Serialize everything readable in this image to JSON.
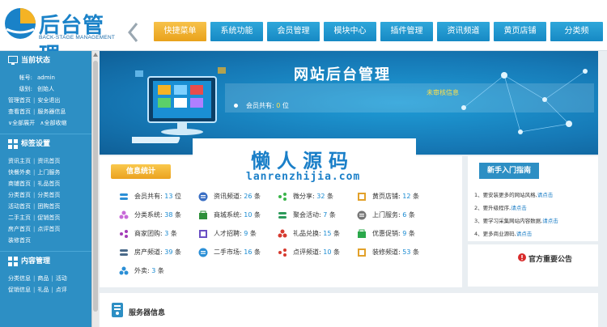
{
  "header": {
    "logo_title": "后台管理",
    "logo_subtitle": "BACK-STAGE MANAGEMENT",
    "nav": [
      "快捷菜单",
      "系统功能",
      "会员管理",
      "模块中心",
      "插件管理",
      "资讯频道",
      "黄页店铺",
      "分类频"
    ],
    "nav_active": 0
  },
  "sidebar": {
    "status": {
      "title": "当前状态",
      "account_label": "帐号:",
      "account_value": "admin",
      "level_label": "级别:",
      "level_value": "创始人",
      "links_row1": [
        "管理首页",
        "安全退出"
      ],
      "links_row2": [
        "查看首页",
        "服务器信息"
      ],
      "links_row3": [
        "全部展开",
        "全部收缩"
      ]
    },
    "tags": {
      "title": "标签设置",
      "rows": [
        [
          "资讯主页",
          "资讯首页"
        ],
        [
          "快餐外卖",
          "上门服务"
        ],
        [
          "商铺首页",
          "礼品首页"
        ],
        [
          "分类首页",
          "分类首页"
        ],
        [
          "活动首页",
          "团购首页"
        ],
        [
          "二手主页",
          "促销首页"
        ],
        [
          "房产首页",
          "点评首页"
        ],
        [
          "装修首页"
        ]
      ]
    },
    "content": {
      "title": "内容管理",
      "rows": [
        [
          "分类信息",
          "商品",
          "活动"
        ],
        [
          "促销信息",
          "礼品",
          "点评"
        ]
      ]
    }
  },
  "banner": {
    "title": "网站后台管理",
    "pending_title": "未审核信息",
    "member_label": "会员共有:",
    "member_count": "0",
    "member_unit": "位"
  },
  "info": {
    "tag": "信息统计",
    "stats": [
      {
        "label": "会员共有:",
        "value": "13",
        "unit": "位",
        "icon": "members-icon",
        "color": "#2b8fd6"
      },
      {
        "label": "资讯频道:",
        "value": "26",
        "unit": "条",
        "icon": "news-icon",
        "color": "#3a6fc4"
      },
      {
        "label": "微分享:",
        "value": "32",
        "unit": "条",
        "icon": "share-icon",
        "color": "#3ab54a"
      },
      {
        "label": "黄页店铺:",
        "value": "12",
        "unit": "条",
        "icon": "yellowpage-icon",
        "color": "#e2a12a"
      },
      {
        "label": "分类系统:",
        "value": "38",
        "unit": "条",
        "icon": "category-icon",
        "color": "#c86ad8"
      },
      {
        "label": "商城系统:",
        "value": "10",
        "unit": "条",
        "icon": "mall-icon",
        "color": "#2e8f3a"
      },
      {
        "label": "聚会活动:",
        "value": "7",
        "unit": "条",
        "icon": "party-icon",
        "color": "#2b9a5a"
      },
      {
        "label": "上门服务:",
        "value": "6",
        "unit": "条",
        "icon": "service-icon",
        "color": "#777777"
      },
      {
        "label": "商家团购:",
        "value": "3",
        "unit": "条",
        "icon": "groupbuy-icon",
        "color": "#a33cb8"
      },
      {
        "label": "人才招聘:",
        "value": "9",
        "unit": "条",
        "icon": "job-icon",
        "color": "#6a4fc4"
      },
      {
        "label": "礼品兑换:",
        "value": "15",
        "unit": "条",
        "icon": "gift-icon",
        "color": "#d63a2f"
      },
      {
        "label": "优惠促销:",
        "value": "9",
        "unit": "条",
        "icon": "promo-icon",
        "color": "#2aa84a"
      },
      {
        "label": "房产频道:",
        "value": "39",
        "unit": "条",
        "icon": "house-icon",
        "color": "#4a6a8a"
      },
      {
        "label": "二手市场:",
        "value": "16",
        "unit": "条",
        "icon": "secondhand-icon",
        "color": "#2b8fd6"
      },
      {
        "label": "点评频道:",
        "value": "10",
        "unit": "条",
        "icon": "review-icon",
        "color": "#d63a2f"
      },
      {
        "label": "装修频道:",
        "value": "53",
        "unit": "条",
        "icon": "decor-icon",
        "color": "#e2a12a"
      },
      {
        "label": "外卖:",
        "value": "3",
        "unit": "条",
        "icon": "takeout-icon",
        "color": "#2b8fd6"
      }
    ]
  },
  "guide": {
    "tag": "新手入门指南",
    "items": [
      {
        "text": "1、要安装更多的网站风格,",
        "link": "请点击"
      },
      {
        "text": "2、要升级程序,",
        "link": "请点击"
      },
      {
        "text": "3、要学习采集网站内容数据,",
        "link": "请点击"
      },
      {
        "text": "4、更多商业源码,",
        "link": "请点击"
      }
    ]
  },
  "notice": {
    "title": "官方重要公告"
  },
  "server": {
    "title": "服务器信息"
  },
  "watermark": {
    "cn": "懒人源码",
    "en": "lanrenzhijia.com"
  }
}
